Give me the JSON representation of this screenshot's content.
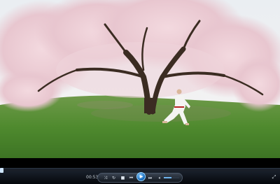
{
  "player": {
    "time_elapsed": "00:53",
    "progress_fraction": 0.0,
    "volume_fraction": 0.5
  },
  "icons": {
    "switch_view": "switch-to-library-icon",
    "shuffle": "shuffle-icon",
    "repeat": "repeat-icon",
    "stop": "stop-icon",
    "previous": "previous-icon",
    "play": "play-icon",
    "next": "next-icon",
    "mute": "speaker-icon",
    "fullscreen": "fullscreen-icon"
  }
}
